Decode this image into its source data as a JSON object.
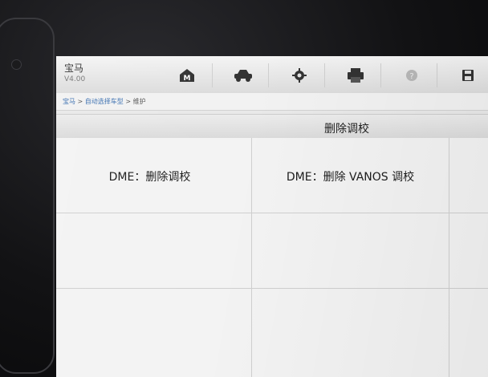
{
  "app": {
    "title": "宝马",
    "version": "V4.00"
  },
  "toolbar": [
    {
      "name": "home-button",
      "icon": "home-m-icon"
    },
    {
      "name": "vehicle-button",
      "icon": "car-icon"
    },
    {
      "name": "settings-button",
      "icon": "gear-icon"
    },
    {
      "name": "print-button",
      "icon": "printer-icon"
    },
    {
      "name": "help-button",
      "icon": "help-icon"
    },
    {
      "name": "save-button",
      "icon": "save-icon"
    }
  ],
  "breadcrumb": {
    "item1": "宝马",
    "sep1": " > ",
    "item2": "自动选择车型",
    "sep2": " > ",
    "item3": "维护"
  },
  "section": {
    "title": "删除调校"
  },
  "functions": {
    "item1": "DME：删除调校",
    "item2": "DME：删除 VANOS 调校"
  },
  "colors": {
    "link": "#3a6fb0",
    "background": "#e9e9e9"
  }
}
